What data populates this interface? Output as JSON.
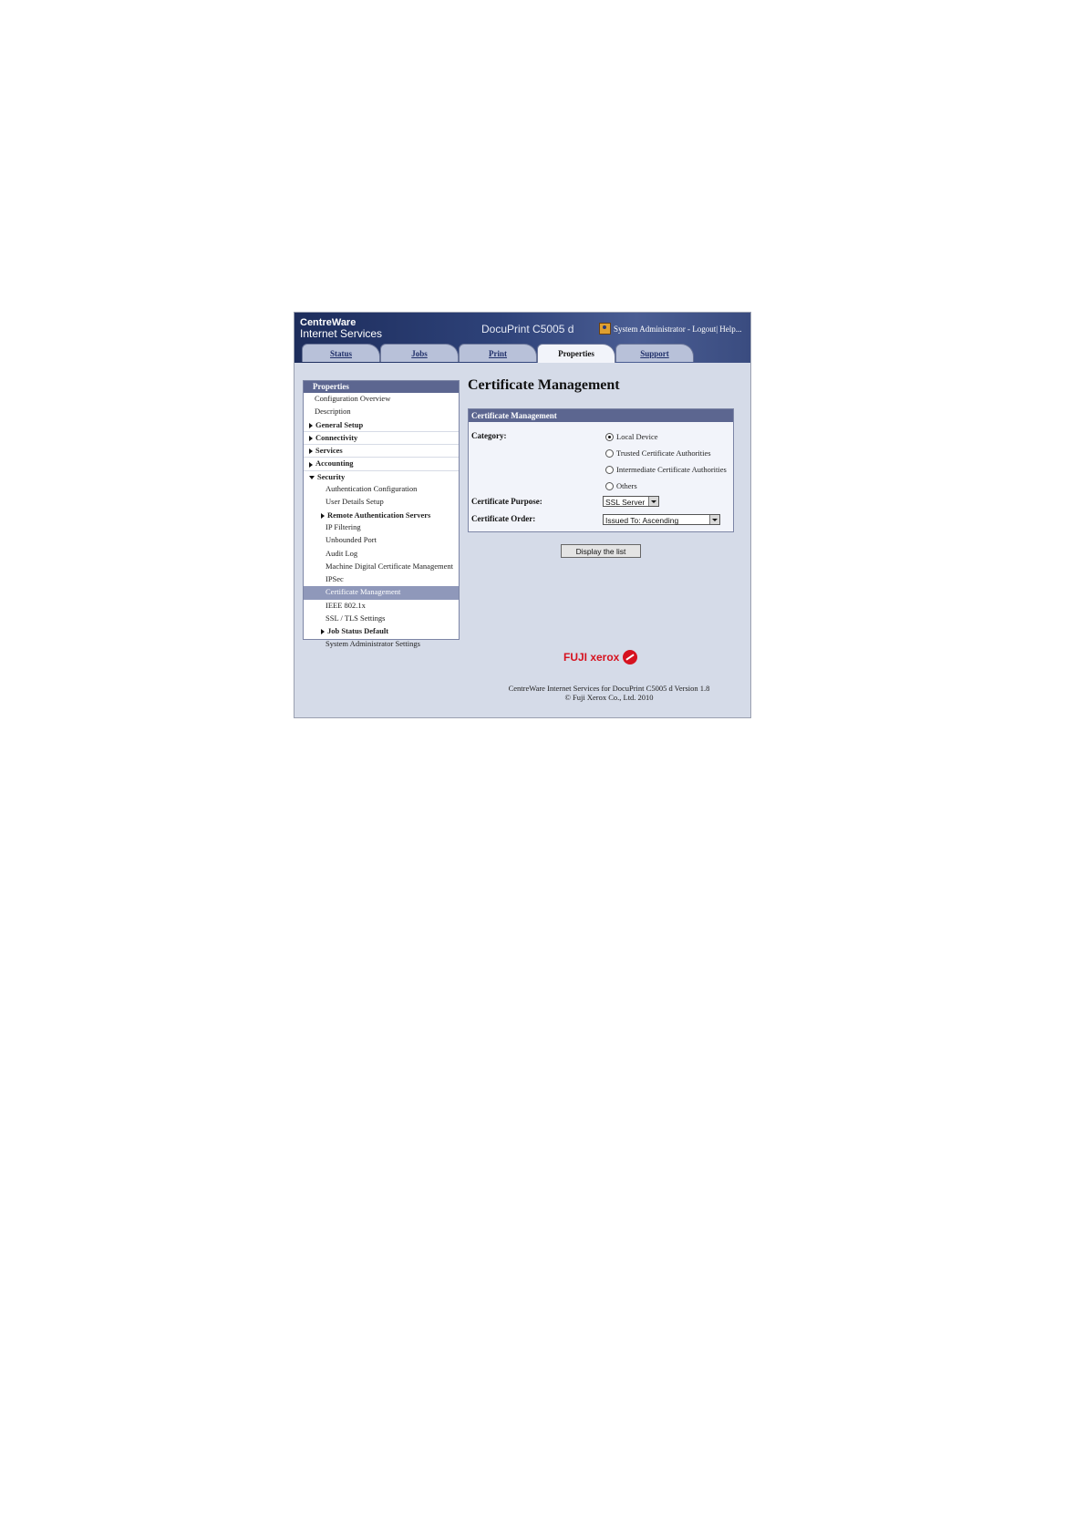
{
  "header": {
    "brand_line1": "CentreWare",
    "brand_line2": "Internet Services",
    "model": "DocuPrint C5005 d",
    "admin_text": "System Administrator - Logout| Help..."
  },
  "tabs": [
    {
      "label": "Status",
      "active": false
    },
    {
      "label": "Jobs",
      "active": false
    },
    {
      "label": "Print",
      "active": false
    },
    {
      "label": "Properties",
      "active": true
    },
    {
      "label": "Support",
      "active": false
    }
  ],
  "nav": {
    "heading": "Properties",
    "items": [
      {
        "label": "Configuration Overview"
      },
      {
        "label": "Description"
      },
      {
        "label": "General Setup"
      },
      {
        "label": "Connectivity"
      },
      {
        "label": "Services"
      },
      {
        "label": "Accounting"
      },
      {
        "label": "Security"
      },
      {
        "label": "Authentication Configuration"
      },
      {
        "label": "User Details Setup"
      },
      {
        "label": "Remote Authentication Servers"
      },
      {
        "label": "IP Filtering"
      },
      {
        "label": "Unbounded Port"
      },
      {
        "label": "Audit Log"
      },
      {
        "label": "Machine Digital Certificate Management"
      },
      {
        "label": "IPSec"
      },
      {
        "label": "Certificate Management"
      },
      {
        "label": "IEEE 802.1x"
      },
      {
        "label": "SSL / TLS Settings"
      },
      {
        "label": "Job Status Default"
      },
      {
        "label": "System Administrator Settings"
      }
    ]
  },
  "main": {
    "title": "Certificate Management",
    "panel_heading": "Certificate Management",
    "category_label": "Category:",
    "category_options": [
      "Local Device",
      "Trusted Certificate Authorities",
      "Intermediate Certificate Authorities",
      "Others"
    ],
    "category_selected": "Local Device",
    "purpose_label": "Certificate Purpose:",
    "purpose_value": "SSL Server",
    "order_label": "Certificate Order:",
    "order_value": "Issued To: Ascending",
    "display_button": "Display the list"
  },
  "footer": {
    "logo_text": "FUJI xerox",
    "line1": "CentreWare Internet Services for DocuPrint C5005 d Version 1.8",
    "line2": "© Fuji Xerox Co., Ltd. 2010"
  },
  "colors": {
    "header_dark": "#1d2d5c",
    "panel_head": "#5c6690",
    "selected_nav": "#8f98ba",
    "xerox_red": "#d6121f"
  }
}
